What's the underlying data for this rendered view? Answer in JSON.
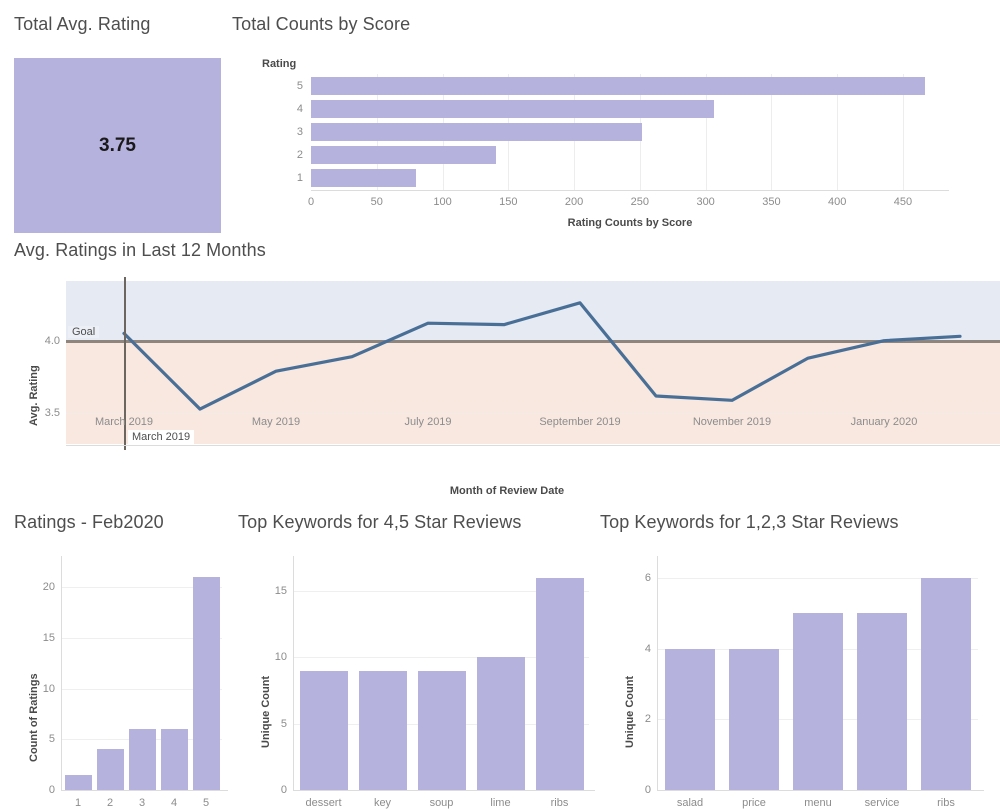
{
  "kpi": {
    "title": "Total Avg. Rating",
    "value": "3.75",
    "tile_color": "#b5b2de"
  },
  "counts": {
    "title": "Total Counts by Score",
    "legend_label": "Rating",
    "xlabel": "Rating Counts by Score"
  },
  "line": {
    "title": "Avg. Ratings in Last 12 Months",
    "ylabel": "Avg. Rating",
    "xlabel": "Month of Review Date",
    "goal_label": "Goal",
    "reference_label": "March 2019"
  },
  "feb": {
    "title": "Ratings - Feb2020",
    "ylabel": "Count of Ratings"
  },
  "kw45": {
    "title": "Top Keywords for 4,5 Star Reviews",
    "ylabel": "Unique Count"
  },
  "kw123": {
    "title": "Top Keywords for 1,2,3 Star Reviews",
    "ylabel": "Unique Count"
  },
  "chart_data": [
    {
      "type": "bar",
      "orientation": "horizontal",
      "title": "Total Counts by Score",
      "xlabel": "Rating Counts by Score",
      "ylabel": "Rating",
      "categories": [
        "5",
        "4",
        "3",
        "2",
        "1"
      ],
      "values": [
        467,
        306,
        252,
        141,
        80
      ],
      "xlim": [
        0,
        485
      ],
      "xticks": [
        0,
        50,
        100,
        150,
        200,
        250,
        300,
        350,
        400,
        450
      ],
      "grid": true,
      "legend": "none",
      "bar_color": "#b5b2de"
    },
    {
      "type": "line",
      "title": "Avg. Ratings in Last 12 Months",
      "xlabel": "Month of Review Date",
      "ylabel": "Avg. Rating",
      "x": [
        "March 2019",
        "April 2019",
        "May 2019",
        "June 2019",
        "July 2019",
        "August 2019",
        "September 2019",
        "October 2019",
        "November 2019",
        "December 2019",
        "January 2020",
        "February 2020"
      ],
      "values": [
        4.05,
        3.53,
        3.79,
        3.89,
        4.12,
        4.11,
        4.26,
        3.62,
        3.59,
        3.88,
        4.0,
        4.03
      ],
      "ylim": [
        3.29,
        4.41
      ],
      "yticks": [
        3.5,
        4.0
      ],
      "xticks": [
        "March 2019",
        "May 2019",
        "July 2019",
        "September 2019",
        "November 2019",
        "January 2020"
      ],
      "goal": 4.0,
      "goal_label": "Goal",
      "reference_line": "March 2019",
      "grid": true,
      "legend": "none",
      "line_color": "#4a6f96",
      "band_above_color": "#e5eaf3",
      "band_below_color": "#f8e8e0",
      "goal_line_color": "#8e857e"
    },
    {
      "type": "bar",
      "orientation": "vertical",
      "title": "Ratings - Feb2020",
      "xlabel": "",
      "ylabel": "Count of Ratings",
      "categories": [
        "1",
        "2",
        "3",
        "4",
        "5"
      ],
      "values": [
        1.5,
        4,
        6,
        6,
        21
      ],
      "ylim": [
        0,
        22.5
      ],
      "yticks": [
        0,
        5,
        10,
        15,
        20
      ],
      "grid": true,
      "legend": "none",
      "bar_color": "#b5b2de"
    },
    {
      "type": "bar",
      "orientation": "vertical",
      "title": "Top Keywords for 4,5 Star Reviews",
      "xlabel": "",
      "ylabel": "Unique Count",
      "categories": [
        "dessert",
        "key",
        "soup",
        "lime",
        "ribs"
      ],
      "values": [
        9,
        9,
        9,
        10,
        16
      ],
      "ylim": [
        0,
        17.2
      ],
      "yticks": [
        0,
        5,
        10,
        15
      ],
      "grid": true,
      "legend": "none",
      "bar_color": "#b5b2de"
    },
    {
      "type": "bar",
      "orientation": "vertical",
      "title": "Top Keywords for 1,2,3 Star Reviews",
      "xlabel": "",
      "ylabel": "Unique Count",
      "categories": [
        "salad",
        "price",
        "menu",
        "service",
        "ribs"
      ],
      "values": [
        4,
        4,
        5,
        5,
        6
      ],
      "ylim": [
        0,
        6.45
      ],
      "yticks": [
        0,
        2,
        4,
        6
      ],
      "grid": true,
      "legend": "none",
      "bar_color": "#b5b2de"
    }
  ]
}
